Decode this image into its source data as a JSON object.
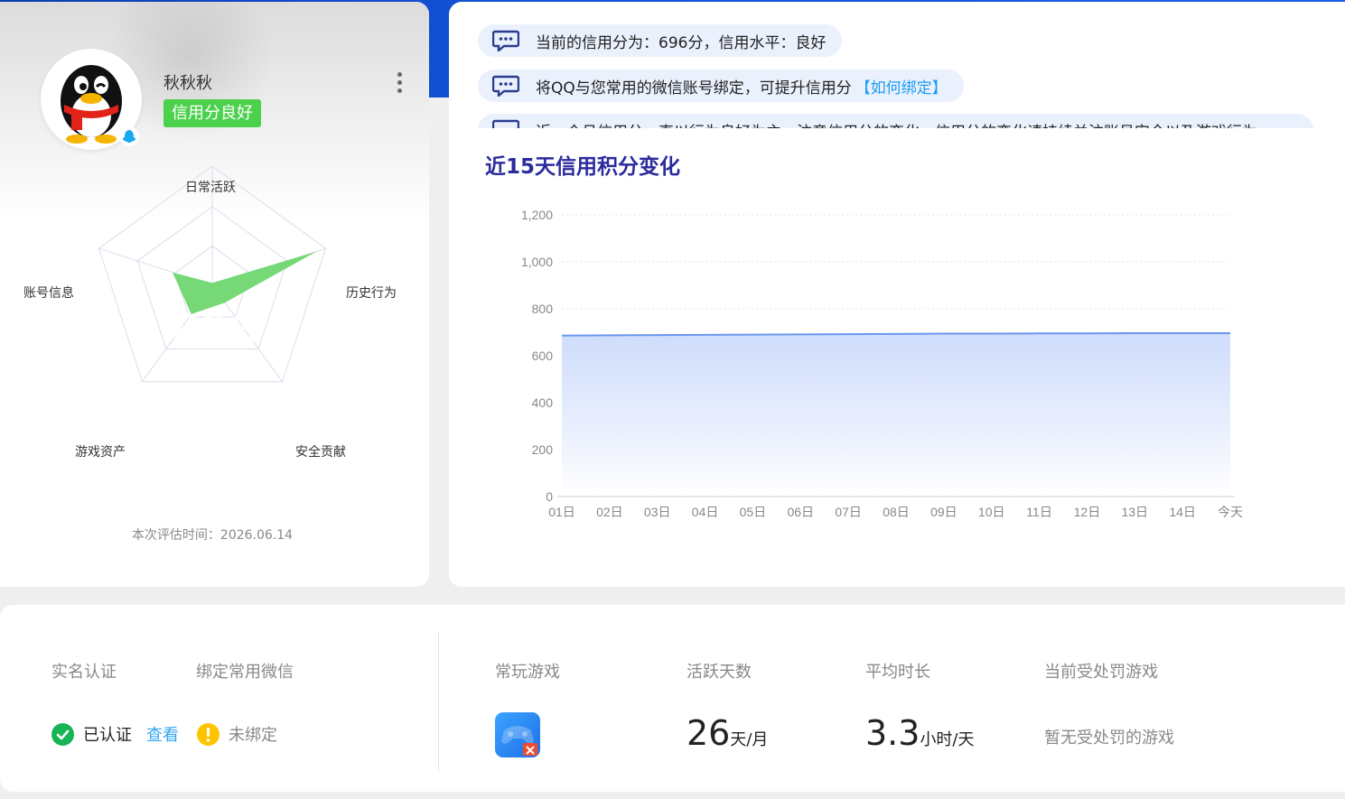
{
  "profile": {
    "username": "秋秋秋",
    "credit_level_badge": "信用分良好",
    "score": "696",
    "eval_time": "本次评估时间：2026.06.14",
    "radar_labels": {
      "daily": "日常活跃",
      "history": "历史行为",
      "security": "安全贡献",
      "assets": "游戏资产",
      "account": "账号信息"
    },
    "radar_values": {
      "daily": 0.0,
      "history": 0.92,
      "security": 0.18,
      "assets": 0.3,
      "account": 0.35
    }
  },
  "notices": [
    {
      "text": "当前的信用分为：696分，信用水平：良好"
    },
    {
      "text": "将QQ与您常用的微信账号绑定，可提升信用分",
      "link": "【如何绑定】"
    },
    {
      "text": "近一个月信用分一直以行为良好为主，注意信用分的变化，信用分的变化请持续关注账号安全以及游戏行为"
    }
  ],
  "chart_title": "近15天信用积分变化",
  "chart_data": {
    "type": "area",
    "categories": [
      "01日",
      "02日",
      "03日",
      "04日",
      "05日",
      "06日",
      "07日",
      "08日",
      "09日",
      "10日",
      "11日",
      "12日",
      "13日",
      "14日",
      "今天"
    ],
    "values": [
      686,
      687,
      688,
      689,
      690,
      691,
      692,
      693,
      694,
      694,
      695,
      695,
      696,
      696,
      696
    ],
    "ylim": [
      0,
      1200
    ],
    "yticks": [
      "0",
      "200",
      "400",
      "600",
      "800",
      "1,000",
      "1,200"
    ],
    "grid": true,
    "line_color": "#6b97ee"
  },
  "stats": {
    "real_name_label": "实名认证",
    "real_name_status": "已认证",
    "real_name_link": "查看",
    "wechat_label": "绑定常用微信",
    "wechat_status": "未绑定",
    "game_label": "常玩游戏",
    "active_label": "活跃天数",
    "active_value": "26",
    "active_unit": "天/月",
    "avg_label": "平均时长",
    "avg_value": "3.3",
    "avg_unit": "小时/天",
    "punish_label": "当前受处罚游戏",
    "punish_value": "暂无受处罚的游戏"
  },
  "colors": {
    "accent_green": "#4cd14c",
    "radar_fill": "#6fd66f",
    "link": "#35a7ef",
    "title": "#2b2b9e"
  }
}
